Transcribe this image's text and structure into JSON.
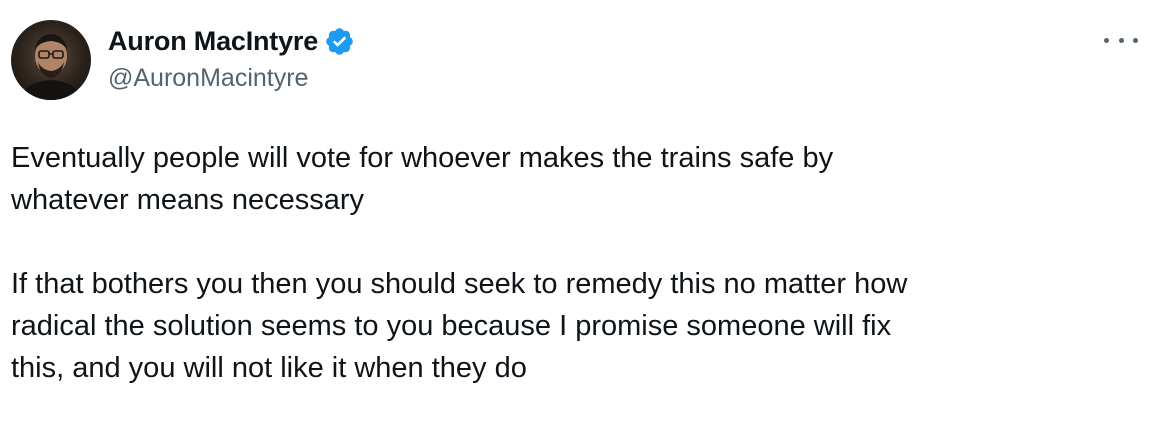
{
  "author": {
    "display_name": "Auron MacIntyre",
    "handle": "@AuronMacintyre",
    "verified": true,
    "avatar_icon": "profile-photo"
  },
  "menu": {
    "icon": "more-options-icon"
  },
  "tweet": {
    "paragraphs": [
      "Eventually people will vote for whoever makes the trains safe by\nwhatever means necessary",
      "If that bothers you then you should seek to remedy this no matter how\nradical the solution seems to you because I promise someone will fix\nthis, and you will not like it when they do"
    ]
  },
  "colors": {
    "text": "#0f1419",
    "secondary_text": "#536471",
    "verified_blue": "#1d9bf0",
    "background": "#ffffff"
  }
}
